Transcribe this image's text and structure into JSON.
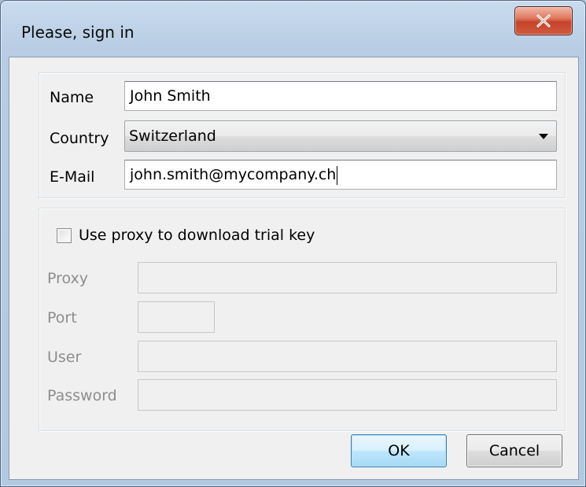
{
  "window": {
    "title": "Please, sign in"
  },
  "form": {
    "name_label": "Name",
    "name_value": "John Smith",
    "country_label": "Country",
    "country_value": "Switzerland",
    "email_label": "E-Mail",
    "email_value": "john.smith@mycompany.ch"
  },
  "proxy": {
    "use_proxy_label": "Use proxy to download trial key",
    "use_proxy_checked": false,
    "proxy_label": "Proxy",
    "proxy_value": "",
    "port_label": "Port",
    "port_value": "",
    "user_label": "User",
    "user_value": "",
    "password_label": "Password",
    "password_value": ""
  },
  "buttons": {
    "ok_label": "OK",
    "cancel_label": "Cancel"
  },
  "icons": {
    "close": "close-icon",
    "dropdown": "chevron-down-icon"
  },
  "colors": {
    "close_button": "#c5422a",
    "default_button_border": "#3c7fb1",
    "disabled_text": "#8d8d8d"
  }
}
